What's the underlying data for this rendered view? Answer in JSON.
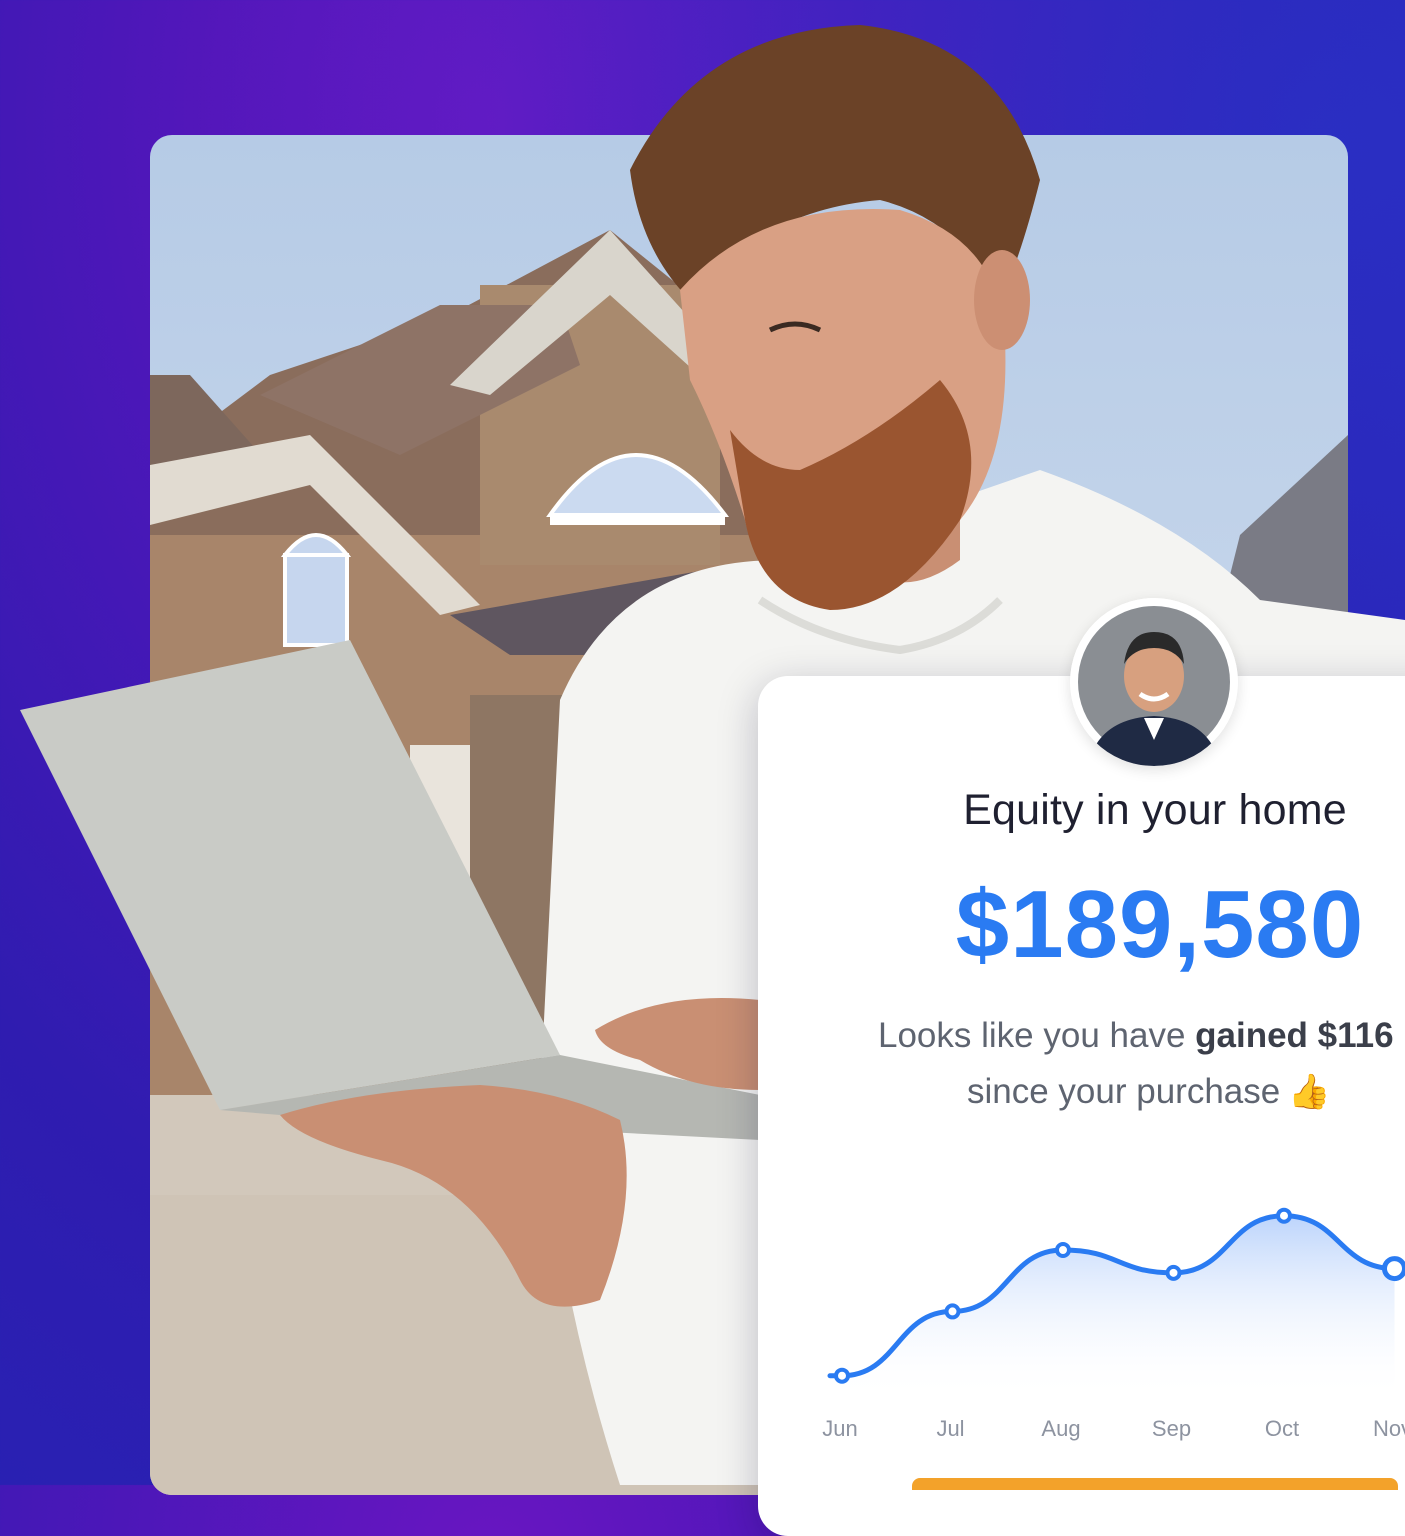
{
  "card": {
    "title": "Equity in your home",
    "amount": "$189,580",
    "message_prefix": "Looks like you have ",
    "message_bold": "gained $116",
    "message_line2": "since your purchase",
    "thumbs_icon": "thumbs-up-icon"
  },
  "colors": {
    "accent": "#2a7bf2",
    "cta": "#f3a22a",
    "background_start": "#6a16c2",
    "background_end": "#2325b4"
  },
  "chart_data": {
    "type": "area",
    "categories": [
      "Jun",
      "Jul",
      "Aug",
      "Sep",
      "Oct",
      "Nov"
    ],
    "values": [
      10,
      55,
      98,
      82,
      122,
      85
    ],
    "title": "",
    "xlabel": "",
    "ylabel": "",
    "ylim": [
      0,
      140
    ],
    "grid": false
  }
}
